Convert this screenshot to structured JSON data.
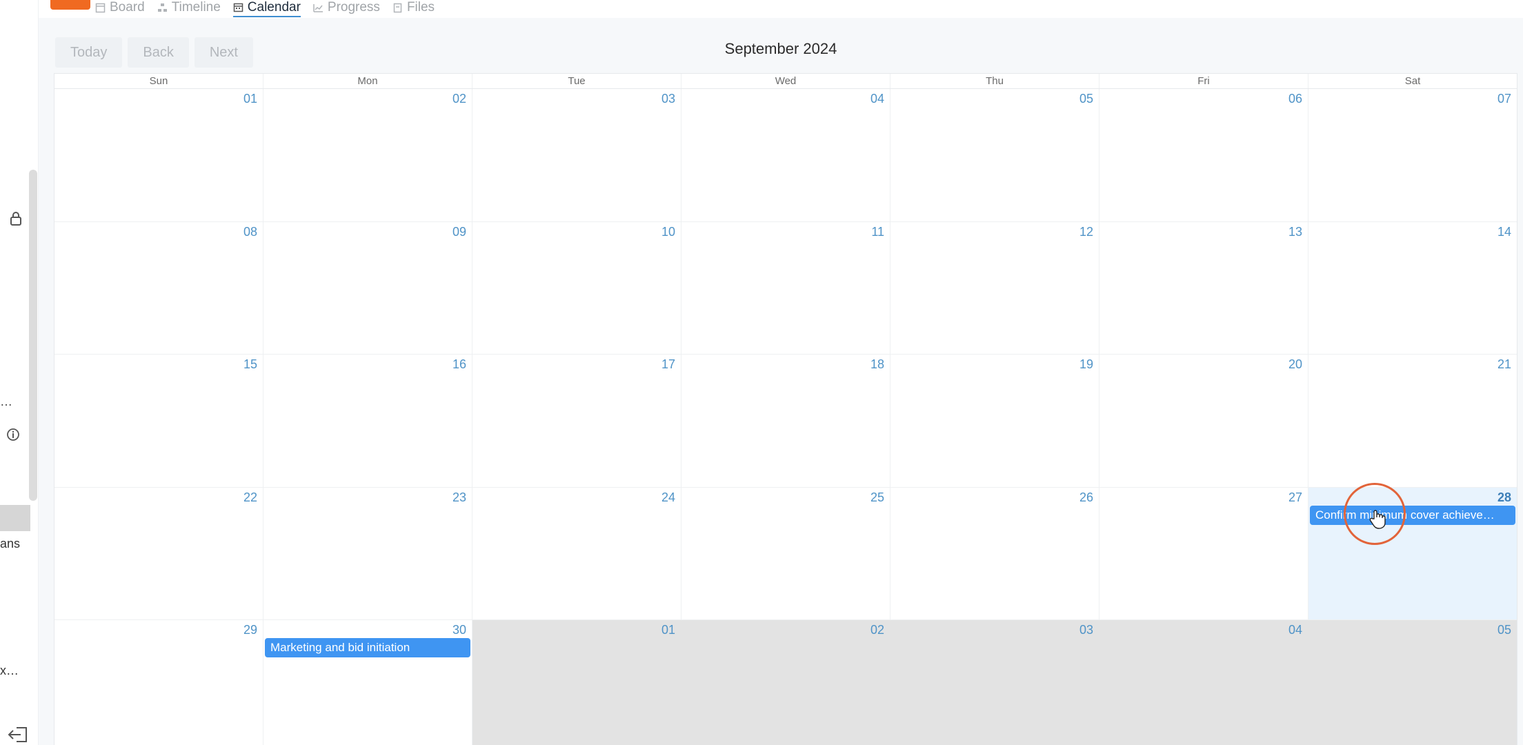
{
  "sidebar": {
    "truncated_items": [
      "…",
      "ans",
      "x…"
    ]
  },
  "tabs": [
    {
      "label": "Board",
      "icon": "board-icon"
    },
    {
      "label": "Timeline",
      "icon": "timeline-icon"
    },
    {
      "label": "Calendar",
      "icon": "calendar-icon",
      "active": true
    },
    {
      "label": "Progress",
      "icon": "progress-icon"
    },
    {
      "label": "Files",
      "icon": "files-icon"
    }
  ],
  "toolbar": {
    "today_label": "Today",
    "back_label": "Back",
    "next_label": "Next"
  },
  "calendar": {
    "title": "September 2024",
    "weekdays": [
      "Sun",
      "Mon",
      "Tue",
      "Wed",
      "Thu",
      "Fri",
      "Sat"
    ],
    "weeks": [
      [
        {
          "n": "01"
        },
        {
          "n": "02"
        },
        {
          "n": "03"
        },
        {
          "n": "04"
        },
        {
          "n": "05"
        },
        {
          "n": "06"
        },
        {
          "n": "07"
        }
      ],
      [
        {
          "n": "08"
        },
        {
          "n": "09"
        },
        {
          "n": "10"
        },
        {
          "n": "11"
        },
        {
          "n": "12"
        },
        {
          "n": "13"
        },
        {
          "n": "14"
        }
      ],
      [
        {
          "n": "15"
        },
        {
          "n": "16"
        },
        {
          "n": "17"
        },
        {
          "n": "18"
        },
        {
          "n": "19"
        },
        {
          "n": "20"
        },
        {
          "n": "21"
        }
      ],
      [
        {
          "n": "22"
        },
        {
          "n": "23"
        },
        {
          "n": "24"
        },
        {
          "n": "25"
        },
        {
          "n": "26"
        },
        {
          "n": "27"
        },
        {
          "n": "28",
          "today": true,
          "event": "Confirm minimum cover achieve…"
        }
      ],
      [
        {
          "n": "29"
        },
        {
          "n": "30",
          "event": "Marketing and bid initiation"
        },
        {
          "n": "01",
          "other": true
        },
        {
          "n": "02",
          "other": true
        },
        {
          "n": "03",
          "other": true
        },
        {
          "n": "04",
          "other": true
        },
        {
          "n": "05",
          "other": true
        }
      ]
    ]
  },
  "colors": {
    "accent": "#3e8ed0",
    "event": "#3f95f2",
    "today_bg": "#e8f3fd",
    "other_month_bg": "#e3e3e3",
    "day_number": "#4f93c7",
    "brand": "#f06a21"
  }
}
